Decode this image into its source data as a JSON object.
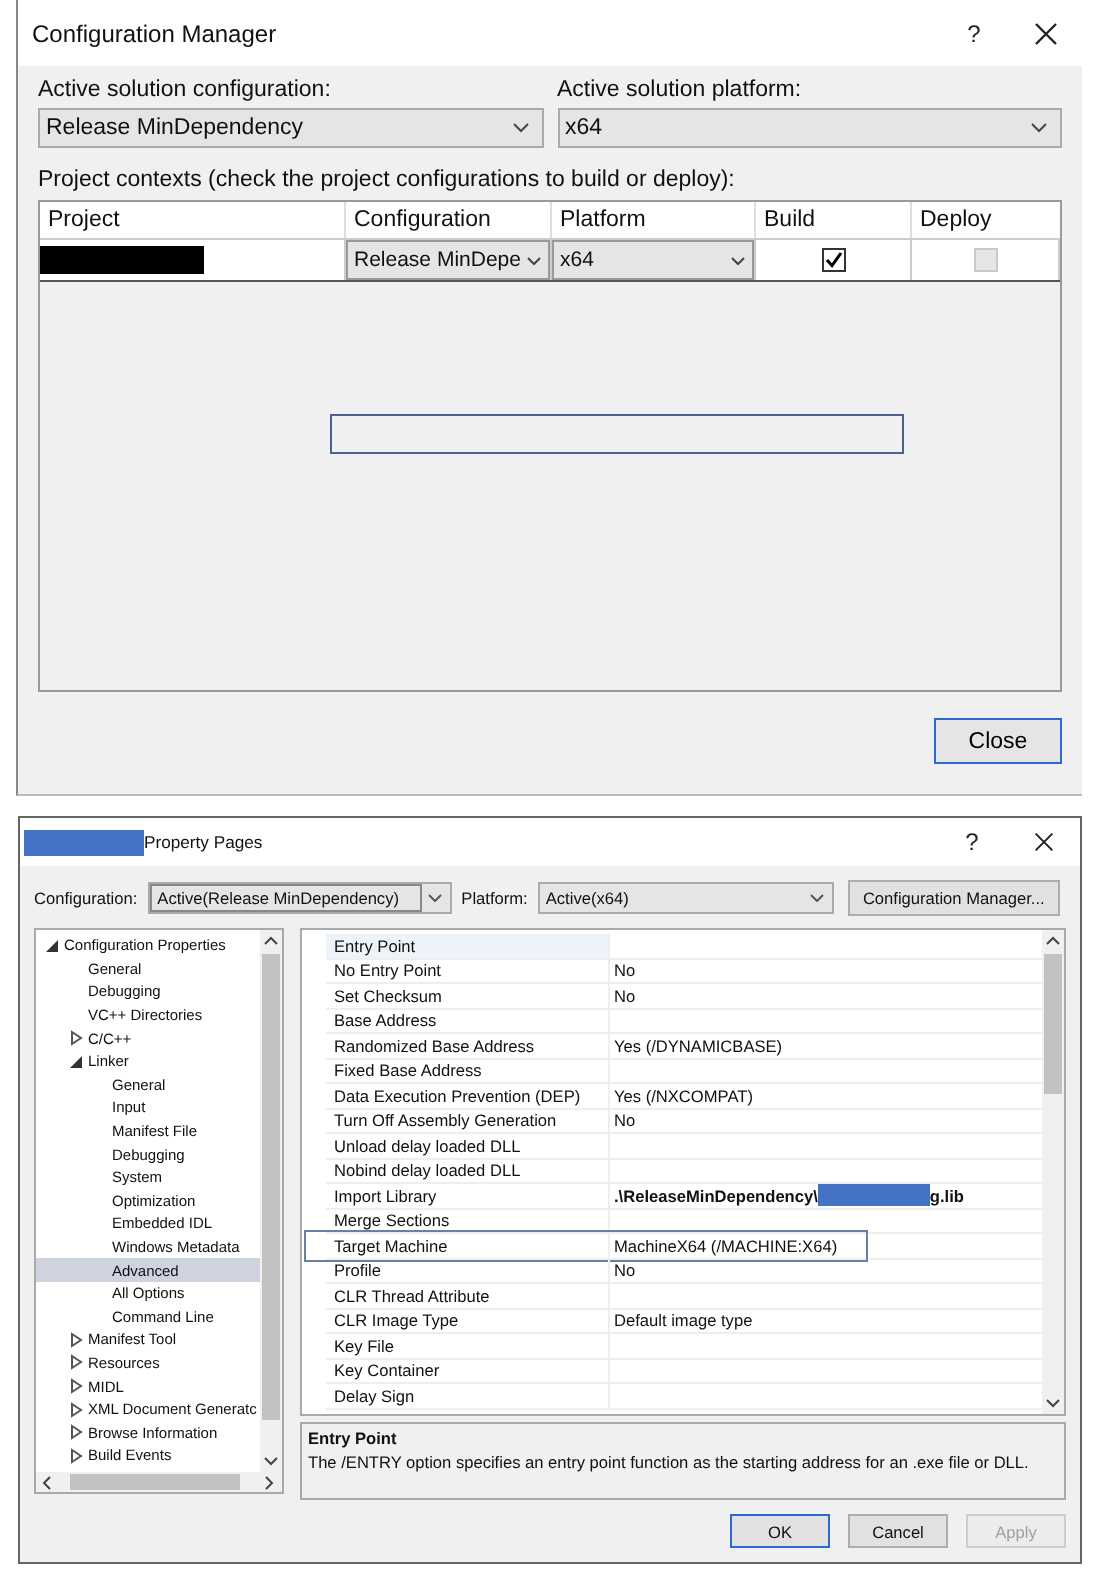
{
  "config_manager": {
    "title": "Configuration Manager",
    "help": "?",
    "active_configuration": {
      "label": "Active solution configuration:",
      "value": "Release MinDependency"
    },
    "active_platform": {
      "label": "Active solution platform:",
      "value": "x64"
    },
    "contexts_label": "Project contexts (check the project configurations to build or deploy):",
    "columns": [
      "Project",
      "Configuration",
      "Platform",
      "Build",
      "Deploy"
    ],
    "rows": [
      {
        "project_redacted": true,
        "configuration": "Release MinDepe",
        "platform": "x64",
        "build": true,
        "deploy": false,
        "deploy_disabled": true
      }
    ],
    "focus_frame": true,
    "close_button": "Close"
  },
  "property_pages": {
    "title": "Property Pages",
    "title_redacted": true,
    "help": "?",
    "configuration_label": "Configuration:",
    "configuration": "Active(Release MinDependency)",
    "platform_label": "Platform:",
    "platform": "Active(x64)",
    "manager_button": "Configuration Manager...",
    "tree": [
      {
        "label": "Configuration Properties",
        "expanded": true,
        "selected": false,
        "children": [
          {
            "label": "General",
            "selected": false
          },
          {
            "label": "Debugging",
            "selected": false
          },
          {
            "label": "VC++ Directories",
            "selected": false
          },
          {
            "label": "C/C++",
            "expanded": false,
            "selected": false
          },
          {
            "label": "Linker",
            "expanded": true,
            "selected": false,
            "children": [
              {
                "label": "General",
                "selected": false
              },
              {
                "label": "Input",
                "selected": false
              },
              {
                "label": "Manifest File",
                "selected": false
              },
              {
                "label": "Debugging",
                "selected": false
              },
              {
                "label": "System",
                "selected": false
              },
              {
                "label": "Optimization",
                "selected": false
              },
              {
                "label": "Embedded IDL",
                "selected": false
              },
              {
                "label": "Windows Metadata",
                "selected": false
              },
              {
                "label": "Advanced",
                "selected": true
              },
              {
                "label": "All Options",
                "selected": false
              },
              {
                "label": "Command Line",
                "selected": false
              }
            ]
          },
          {
            "label": "Manifest Tool",
            "expanded": false,
            "selected": false
          },
          {
            "label": "Resources",
            "expanded": false,
            "selected": false
          },
          {
            "label": "MIDL",
            "expanded": false,
            "selected": false
          },
          {
            "label": "XML Document Generatc",
            "expanded": false,
            "selected": false
          },
          {
            "label": "Browse Information",
            "expanded": false,
            "selected": false
          },
          {
            "label": "Build Events",
            "expanded": false,
            "selected": false
          }
        ]
      }
    ],
    "properties": [
      {
        "name": "Entry Point",
        "selected": true,
        "highlighted": false
      },
      {
        "name": "No Entry Point",
        "value": "No",
        "selected": false,
        "modified": false,
        "highlighted": false
      },
      {
        "name": "Set Checksum",
        "value": "No",
        "selected": false,
        "modified": false,
        "highlighted": false
      },
      {
        "name": "Base Address",
        "selected": false,
        "highlighted": false
      },
      {
        "name": "Randomized Base Address",
        "value": "Yes (/DYNAMICBASE)",
        "selected": false,
        "modified": false,
        "highlighted": false
      },
      {
        "name": "Fixed Base Address",
        "selected": false,
        "highlighted": false
      },
      {
        "name": "Data Execution Prevention (DEP)",
        "value": "Yes (/NXCOMPAT)",
        "selected": false,
        "modified": false,
        "highlighted": false
      },
      {
        "name": "Turn Off Assembly Generation",
        "value": "No",
        "selected": false,
        "modified": false,
        "highlighted": false
      },
      {
        "name": "Unload delay loaded DLL",
        "selected": false,
        "highlighted": false
      },
      {
        "name": "Nobind delay loaded DLL",
        "selected": false,
        "highlighted": false
      },
      {
        "name": "Import Library",
        "value": ".\\ReleaseMinDependency\\",
        "value_redacted": true,
        "value_end": "g.lib",
        "selected": false,
        "modified": true,
        "highlighted": false
      },
      {
        "name": "Merge Sections",
        "selected": false,
        "highlighted": false
      },
      {
        "name": "Target Machine",
        "value": "MachineX64 (/MACHINE:X64)",
        "selected": false,
        "modified": false,
        "highlighted": true
      },
      {
        "name": "Profile",
        "value": "No",
        "selected": false,
        "modified": false,
        "highlighted": false
      },
      {
        "name": "CLR Thread Attribute",
        "selected": false,
        "highlighted": false
      },
      {
        "name": "CLR Image Type",
        "value": "Default image type",
        "selected": false,
        "modified": false,
        "highlighted": false
      },
      {
        "name": "Key File",
        "selected": false,
        "highlighted": false
      },
      {
        "name": "Key Container",
        "selected": false,
        "highlighted": false
      },
      {
        "name": "Delay Sign",
        "selected": false,
        "highlighted": false
      }
    ],
    "description": {
      "title": "Entry Point",
      "text": "The /ENTRY option specifies an entry point function as the starting address for an .exe file or DLL."
    },
    "buttons": [
      {
        "label": "OK",
        "kind": "default",
        "disabled": false
      },
      {
        "label": "Cancel",
        "kind": "normal",
        "disabled": false
      },
      {
        "label": "Apply",
        "kind": "normal",
        "disabled": true
      }
    ]
  }
}
